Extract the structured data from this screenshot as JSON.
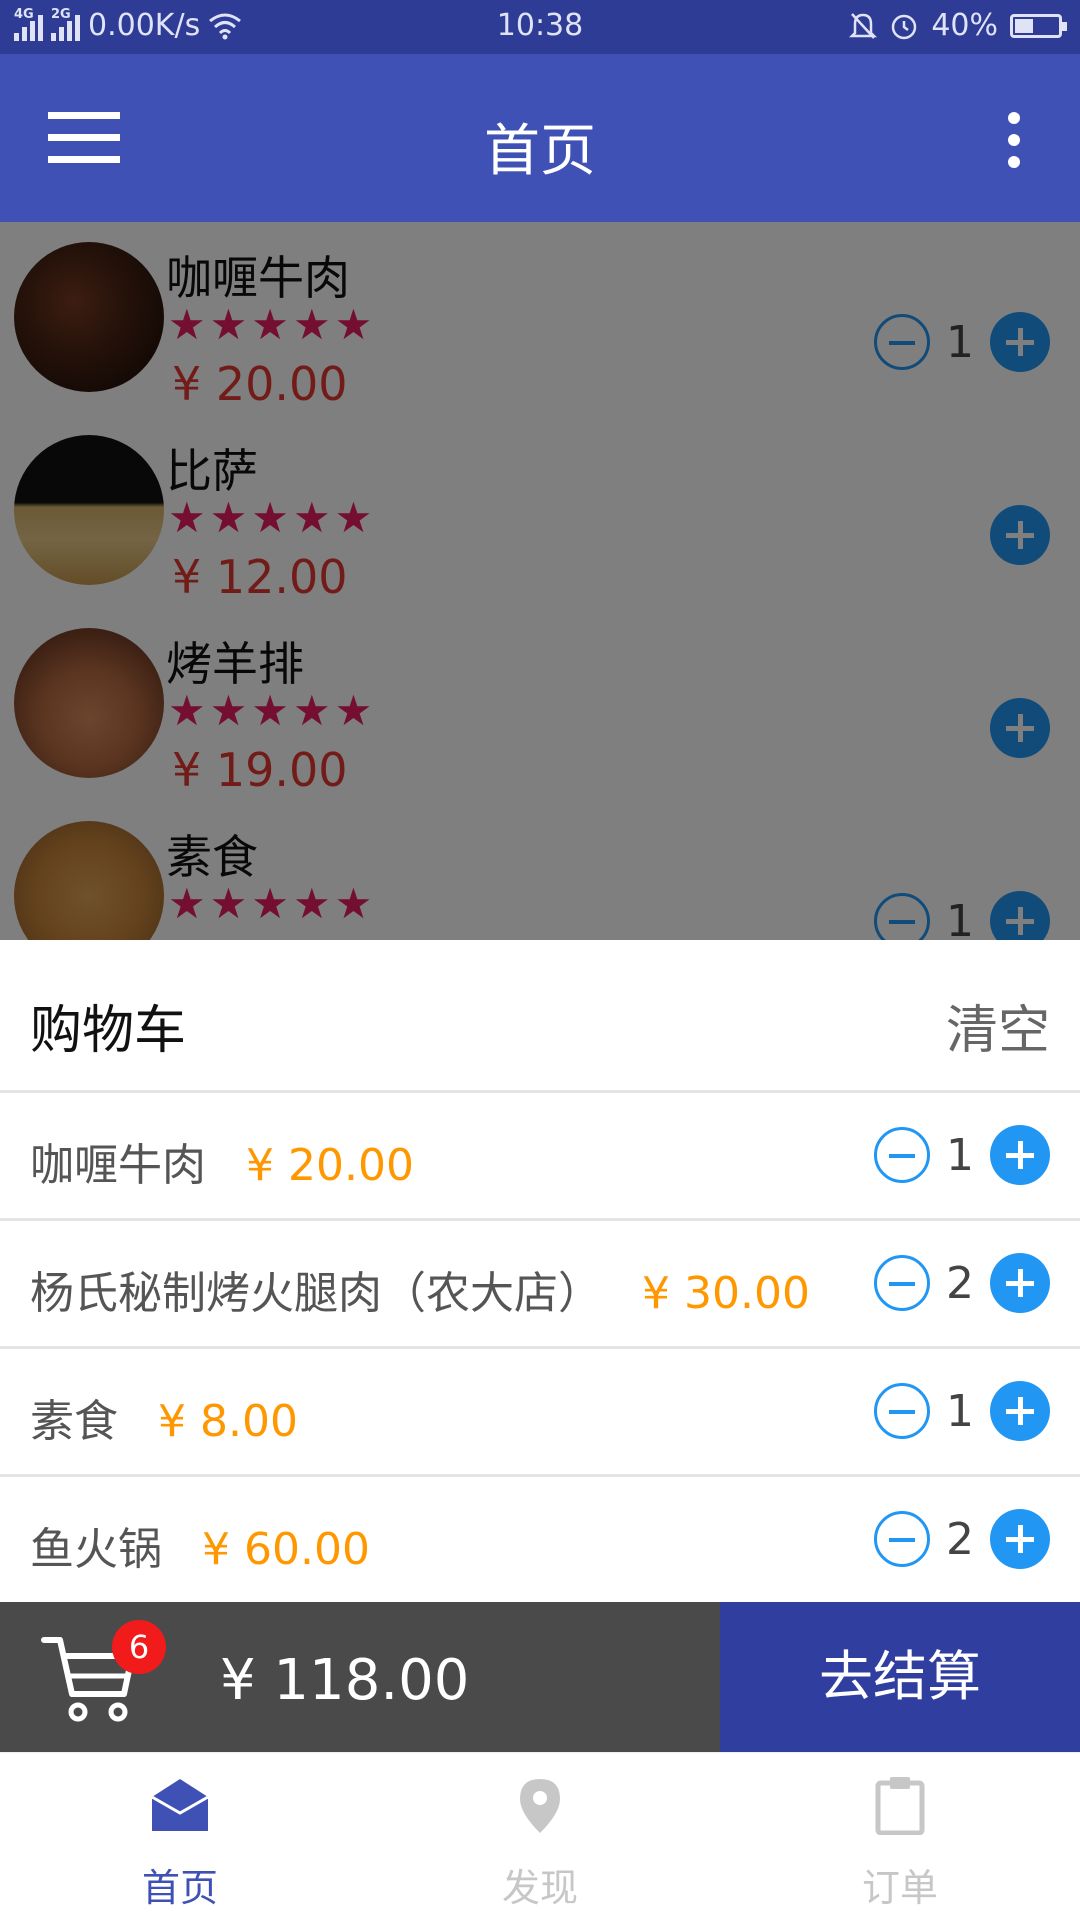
{
  "status_bar": {
    "network_left": "4G",
    "network_right": "2G",
    "speed": "0.00K/s",
    "time": "10:38",
    "battery": "40%",
    "battery_level": 0.4
  },
  "app_bar": {
    "title": "首页"
  },
  "food_list": [
    {
      "name": "咖喱牛肉",
      "stars": "★★★★★",
      "price": "¥ 20.00",
      "qty": "1",
      "has_minus": true
    },
    {
      "name": "比萨",
      "stars": "★★★★★",
      "price": "¥ 12.00",
      "qty": "",
      "has_minus": false
    },
    {
      "name": "烤羊排",
      "stars": "★★★★★",
      "price": "¥ 19.00",
      "qty": "",
      "has_minus": false
    },
    {
      "name": "素食",
      "stars": "★★★★★",
      "price": "",
      "qty": "1",
      "has_minus": true
    }
  ],
  "cart": {
    "title": "购物车",
    "clear_label": "清空",
    "items": [
      {
        "name": "咖喱牛肉",
        "price": "¥ 20.00",
        "qty": "1"
      },
      {
        "name": "杨氏秘制烤火腿肉（农大店）",
        "price": "¥ 30.00",
        "qty": "2"
      },
      {
        "name": "素食",
        "price": "¥ 8.00",
        "qty": "1"
      },
      {
        "name": "鱼火锅",
        "price": "¥ 60.00",
        "qty": "2"
      }
    ]
  },
  "checkout": {
    "badge_count": "6",
    "total": "¥ 118.00",
    "button_label": "去结算"
  },
  "bottom_nav": [
    {
      "label": "首页",
      "icon": "envelope-icon",
      "active": true
    },
    {
      "label": "发现",
      "icon": "location-pin-icon",
      "active": false
    },
    {
      "label": "订单",
      "icon": "clipboard-icon",
      "active": false
    }
  ],
  "colors": {
    "primary": "#3f51b5",
    "primary_dark": "#303f9f",
    "accent": "#2196f3",
    "price_orange": "#ff9800",
    "star_pink": "#e91e63",
    "nav_active": "#3f51b5",
    "nav_inactive": "#c7c7c7"
  }
}
